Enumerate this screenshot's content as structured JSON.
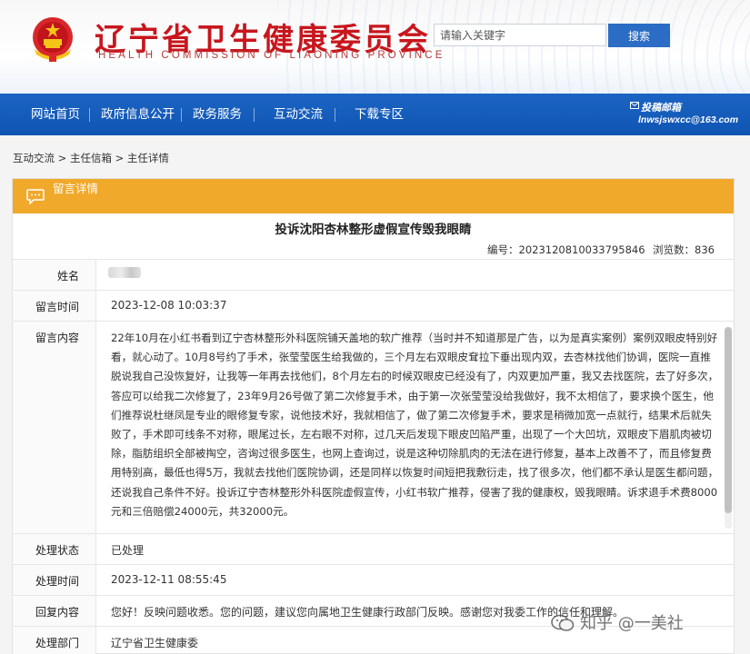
{
  "header": {
    "title": "辽宁省卫生健康委员会",
    "subtitle": "HEALTH COMMISSION OF LIAONING PROVINCE",
    "search_placeholder": "请输入关键字",
    "search_button": "搜索"
  },
  "nav": {
    "items": [
      "网站首页",
      "政府信息公开",
      "政务服务",
      "互动交流",
      "下载专区"
    ],
    "mailbox_label": "投稿邮箱",
    "mailbox_email": "lnwsjswxcc@163.com"
  },
  "breadcrumb": [
    "互动交流",
    "主任信箱",
    "主任详情"
  ],
  "breadcrumb_separator": ">",
  "panel": {
    "header_label": "留言详情",
    "title": "投诉沈阳杏林整形虚假宣传毁我眼睛",
    "number_label": "编号：",
    "number": "20231208100337958 46",
    "views_label": "浏览数：",
    "views": "836"
  },
  "rows": {
    "name_label": "姓名",
    "time_label": "留言时间",
    "time_value": "2023-12-08 10:03:37",
    "content_label": "留言内容",
    "content_value": "22年10月在小红书看到辽宁杏林整形外科医院铺天盖地的软广推荐（当时并不知道那是广告，以为是真实案例）案例双眼皮特别好看，就心动了。10月8号约了手术，张莹莹医生给我做的，三个月左右双眼皮耷拉下垂出现内双，去杏林找他们协调，医院一直推脱说我自己没恢复好，让我等一年再去找他们，8个月左右的时候双眼皮已经没有了，内双更加严重，我又去找医院，去了好多次，答应可以给我二次修复了，23年9月26号做了第二次修复手术，由于第一次张莹莹没给我做好，我不太相信了，要求换个医生，他们推荐说杜继凤是专业的眼修复专家，说他技术好，我就相信了，做了第二次修复手术，要求是稍微加宽一点就行，结果术后就失败了，手术即可线条不对称，眼尾过长，左右眼不对称，过几天后发现下眼皮凹陷严重，出现了一个大凹坑，双眼皮下眉肌肉被切除，脂肪组织全部被掏空，咨询过很多医生，也网上查询过，说是这种切除肌肉的无法在进行修复，基本上改善不了，而且修复费用特别高，最低也得5万，我就去找他们医院协调，还是同样以恢复时间短把我敷衍走，找了很多次，他们都不承认是医生都问题，还说我自己条件不好。投诉辽宁杏林整形外科医院虚假宣传，小红书软广推荐，侵害了我的健康权，毁我眼睛。诉求退手术费8000元和三倍赔偿24000元，共32000元。",
    "status_label": "处理状态",
    "status_value": "已处理",
    "handle_time_label": "处理时间",
    "handle_time_value": "2023-12-11 08:55:45",
    "reply_label": "回复内容",
    "reply_value": "您好！反映问题收悉。您的问题，建议您向属地卫生健康行政部门反映。感谢您对我委工作的信任和理解。",
    "dept_label": "处理部门",
    "dept_value": "辽宁省卫生健康委"
  },
  "watermark": "知乎 @一美社",
  "colors": {
    "nav_blue": "#1560bd",
    "title_red": "#c8161d",
    "panel_orange": "#f0a92b",
    "search_button": "#2b6cc4"
  }
}
